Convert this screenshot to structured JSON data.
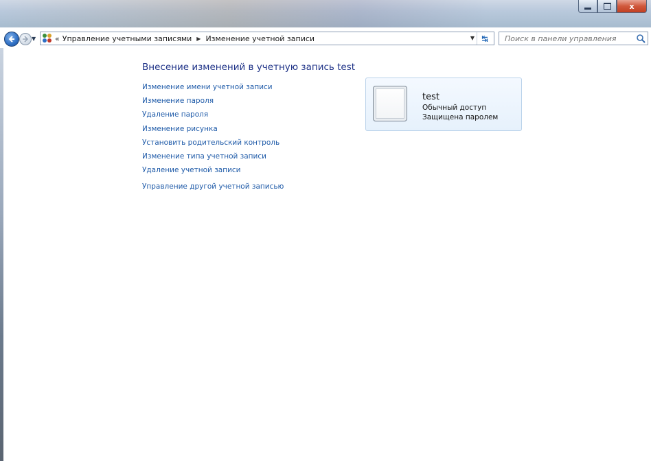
{
  "window": {
    "controls": {
      "minimize": "–",
      "maximize": "□",
      "close": "x"
    }
  },
  "nav": {
    "breadcrumb_prefix": "«",
    "breadcrumbs": [
      "Управление учетными записями",
      "Изменение учетной записи"
    ],
    "search_placeholder": "Поиск в панели управления"
  },
  "main": {
    "title": "Внесение изменений в учетную запись test",
    "links": [
      "Изменение имени учетной записи",
      "Изменение пароля",
      "Удаление пароля",
      "Изменение рисунка",
      "Установить родительский контроль",
      "Изменение типа учетной записи",
      "Удаление учетной записи"
    ],
    "other_link": "Управление другой учетной записью"
  },
  "user": {
    "name": "test",
    "type": "Обычный доступ",
    "status": "Защищена паролем"
  },
  "colors": {
    "link": "#1e5aa8",
    "title": "#1e3287",
    "card_border": "#b9d2ea"
  }
}
